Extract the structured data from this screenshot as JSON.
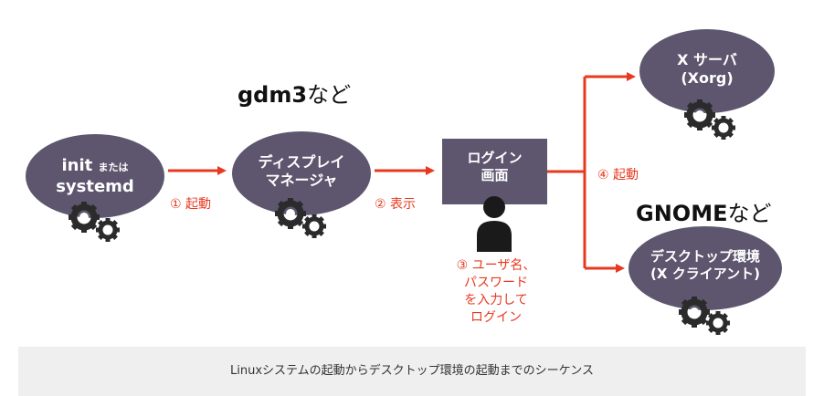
{
  "nodes": {
    "init": {
      "line1": "init",
      "line1_small": "または",
      "line2": "systemd"
    },
    "display_manager": {
      "line1": "ディスプレイ",
      "line2": "マネージャ"
    },
    "login_screen": {
      "line1": "ログイン",
      "line2": "画面"
    },
    "x_server": {
      "line1": "X サーバ",
      "line2": "(Xorg)"
    },
    "desktop": {
      "line1": "デスクトップ環境",
      "line2": "(X クライアント)"
    }
  },
  "labels": {
    "gdm3_bold": "gdm3",
    "gdm3_rest": "など",
    "gnome_bold": "GNOME",
    "gnome_rest": "など"
  },
  "steps": {
    "step1": "① 起動",
    "step2": "② 表示",
    "step3": [
      "③ ユーザ名、",
      "パスワード",
      "を入力して",
      "ログイン"
    ],
    "step4": "④ 起動"
  },
  "caption": "Linuxシステムの起動からデスクトップ環境の起動までのシーケンス",
  "colors": {
    "node_fill": "#5d566e",
    "arrow": "#e8391f",
    "gear": "#2b2b2b",
    "user_icon": "#1a1a1a",
    "caption_bg": "#efefef"
  }
}
